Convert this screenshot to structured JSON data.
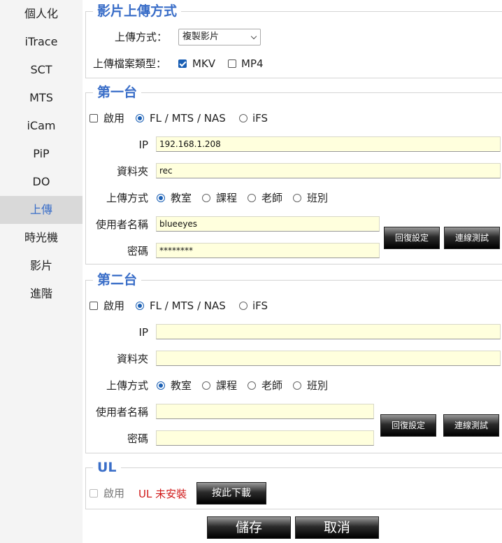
{
  "sidebar": {
    "items": [
      {
        "label": "個人化"
      },
      {
        "label": "iTrace"
      },
      {
        "label": "SCT"
      },
      {
        "label": "MTS"
      },
      {
        "label": "iCam"
      },
      {
        "label": "PiP"
      },
      {
        "label": "DO"
      },
      {
        "label": "上傳"
      },
      {
        "label": "時光機"
      },
      {
        "label": "影片"
      },
      {
        "label": "進階"
      }
    ],
    "active_index": 7
  },
  "upload_method": {
    "title": "影片上傳方式",
    "method_label": "上傳方式：",
    "method_value": "複製影片",
    "filetype_label": "上傳檔案類型：",
    "mkv_label": "MKV",
    "mkv_checked": true,
    "mp4_label": "MP4",
    "mp4_checked": false
  },
  "server1": {
    "title": "第一台",
    "enable_label": "啟用",
    "enabled": false,
    "mode_fl": "FL / MTS / NAS",
    "mode_ifs": "iFS",
    "selected_mode": "FL / MTS / NAS",
    "ip_label": "IP",
    "ip_value": "192.168.1.208",
    "folder_label": "資料夾",
    "folder_value": "rec",
    "upload_label": "上傳方式",
    "upload_options": [
      "教室",
      "課程",
      "老師",
      "班別"
    ],
    "upload_selected": "教室",
    "username_label": "使用者名稱",
    "username_value": "blueeyes",
    "password_label": "密碼",
    "password_value": "********",
    "reset_label": "回復設定",
    "test_label": "連線測試"
  },
  "server2": {
    "title": "第二台",
    "enable_label": "啟用",
    "enabled": false,
    "mode_fl": "FL / MTS / NAS",
    "mode_ifs": "iFS",
    "selected_mode": "FL / MTS / NAS",
    "ip_label": "IP",
    "ip_value": "",
    "folder_label": "資料夾",
    "folder_value": "",
    "upload_label": "上傳方式",
    "upload_options": [
      "教室",
      "課程",
      "老師",
      "班別"
    ],
    "upload_selected": "教室",
    "username_label": "使用者名稱",
    "username_value": "",
    "password_label": "密碼",
    "password_value": "",
    "reset_label": "回復設定",
    "test_label": "連線測試"
  },
  "ul": {
    "title": "UL",
    "enable_label": "啟用",
    "status": "UL 未安裝",
    "download_label": "按此下載"
  },
  "footer": {
    "save_label": "儲存",
    "cancel_label": "取消"
  },
  "colors": {
    "accent": "#3a6ec8",
    "input_bg": "#ffffdd",
    "warning": "#d01818",
    "sidebar_bg": "#f4f4f4",
    "sidebar_active_bg": "#d9d9d9"
  }
}
